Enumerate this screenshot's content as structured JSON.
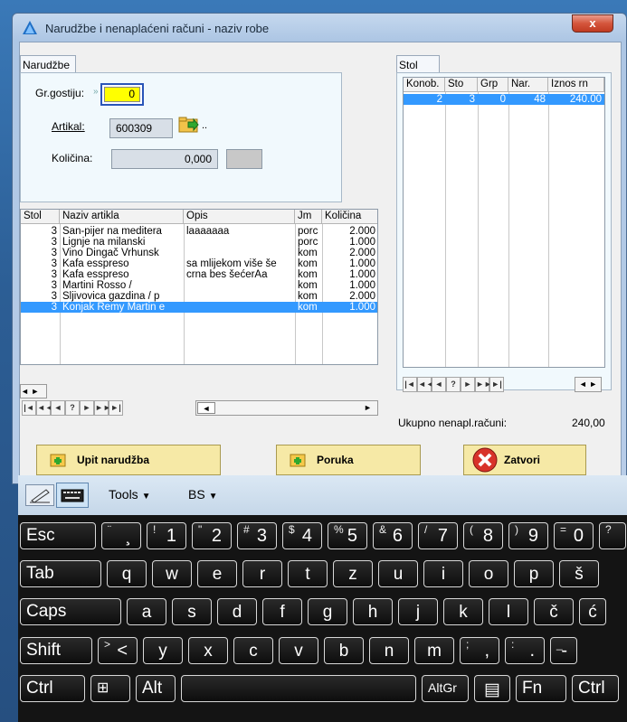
{
  "window": {
    "title": "Narudžbe i nenaplaćeni računi - naziv robe",
    "close_glyph": "x"
  },
  "left_tab": {
    "label": "Narudžbe"
  },
  "right_tab": {
    "label": "Stol"
  },
  "form": {
    "guests_label": "Gr.gostiju:",
    "guests_value": "0",
    "article_label": "Artikal:",
    "article_value": "600309",
    "article_dots": "..",
    "qty_label": "Količina:",
    "qty_value": "0,000"
  },
  "items_grid": {
    "headers": [
      "Stol",
      "Naziv artikla",
      "Opis",
      "Jm",
      "Količina"
    ],
    "rows": [
      [
        "3",
        "Šan-pijer na meditera",
        "laaaaaaa",
        "porc",
        "2.000"
      ],
      [
        "3",
        "Lignje na milanski",
        "",
        "porc",
        "1.000"
      ],
      [
        "3",
        "Vino Dingač Vrhunsk",
        "",
        "kom",
        "2.000"
      ],
      [
        "3",
        "Kafa esspreso",
        "sa mlijekom više še",
        "kom",
        "1.000"
      ],
      [
        "3",
        "Kafa esspreso",
        "crna bes šećerAa",
        "kom",
        "1.000"
      ],
      [
        "3",
        "Martini Rosso /",
        "",
        "kom",
        "1.000"
      ],
      [
        "3",
        "Šljivovica gazdina / p",
        "",
        "kom",
        "2.000"
      ],
      [
        "3",
        "Konjak Remy Martin e",
        "",
        "kom",
        "1.000"
      ]
    ],
    "selected_row": 7
  },
  "tables_grid": {
    "headers": [
      "Konob.",
      "Sto",
      "Grp",
      "Nar.",
      "Iznos rn"
    ],
    "rows": [
      [
        "2",
        "3",
        "0",
        "48",
        "240.00"
      ]
    ],
    "selected_row": 0
  },
  "navigator": {
    "buttons": [
      "|◄",
      "◄◄",
      "◄",
      "?",
      "►",
      "►►",
      "►|"
    ]
  },
  "total": {
    "label": "Ukupno nenapl.računi:",
    "value": "240,00"
  },
  "buttons": {
    "order": "Upit narudžba",
    "message": "Poruka",
    "close": "Zatvori"
  },
  "keyboard": {
    "tools_label": "Tools",
    "bs_label": "BS",
    "rows": [
      [
        {
          "main": "Esc"
        },
        {
          "shift": "¨",
          "main": "¸"
        },
        {
          "shift": "!",
          "main": "1"
        },
        {
          "shift": "\"",
          "main": "2"
        },
        {
          "shift": "#",
          "main": "3"
        },
        {
          "shift": "$",
          "main": "4"
        },
        {
          "shift": "%",
          "main": "5"
        },
        {
          "shift": "&",
          "main": "6"
        },
        {
          "shift": "/",
          "main": "7"
        },
        {
          "shift": "(",
          "main": "8"
        },
        {
          "shift": ")",
          "main": "9"
        },
        {
          "shift": "=",
          "main": "0"
        },
        {
          "shift": "?",
          "main": ""
        }
      ],
      [
        {
          "main": "Tab"
        },
        {
          "main": "q"
        },
        {
          "main": "w"
        },
        {
          "main": "e"
        },
        {
          "main": "r"
        },
        {
          "main": "t"
        },
        {
          "main": "z"
        },
        {
          "main": "u"
        },
        {
          "main": "i"
        },
        {
          "main": "o"
        },
        {
          "main": "p"
        },
        {
          "main": "š"
        }
      ],
      [
        {
          "main": "Caps"
        },
        {
          "main": "a"
        },
        {
          "main": "s"
        },
        {
          "main": "d"
        },
        {
          "main": "f"
        },
        {
          "main": "g"
        },
        {
          "main": "h"
        },
        {
          "main": "j"
        },
        {
          "main": "k"
        },
        {
          "main": "l"
        },
        {
          "main": "č"
        },
        {
          "main": "ć"
        }
      ],
      [
        {
          "main": "Shift"
        },
        {
          "shift": ">",
          "main": "<"
        },
        {
          "main": "y"
        },
        {
          "main": "x"
        },
        {
          "main": "c"
        },
        {
          "main": "v"
        },
        {
          "main": "b"
        },
        {
          "main": "n"
        },
        {
          "main": "m"
        },
        {
          "shift": ";",
          "main": ","
        },
        {
          "shift": ":",
          "main": "."
        },
        {
          "shift": "_",
          "main": "-"
        }
      ],
      [
        {
          "main": "Ctrl"
        },
        {
          "main": "win"
        },
        {
          "main": "Alt"
        },
        {
          "main": ""
        },
        {
          "main": "AltGr"
        },
        {
          "main": "▤"
        },
        {
          "main": "Fn"
        },
        {
          "main": "Ctrl"
        }
      ]
    ]
  }
}
